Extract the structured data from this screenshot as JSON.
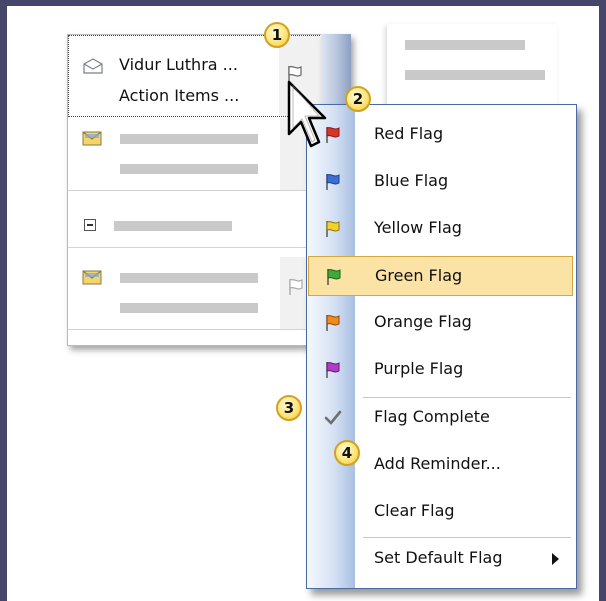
{
  "colors": {
    "background": "#45466a",
    "menu_border": "#4b6aa5",
    "highlight_fill": "#fbe3a6",
    "highlight_border": "#d1a740",
    "callout_fill": "#fde57d",
    "red_flag": "#d9342b",
    "blue_flag": "#3b6fd6",
    "yellow_flag": "#f2d12b",
    "green_flag": "#3faa3a",
    "orange_flag": "#f08a1c",
    "purple_flag": "#b23cc9"
  },
  "message_list": {
    "row1": {
      "sender": "Vidur Luthra ...",
      "subject": "Action Items ..."
    }
  },
  "context_menu": {
    "items": [
      {
        "label": "Red Flag",
        "icon": "red-flag-icon"
      },
      {
        "label": "Blue Flag",
        "icon": "blue-flag-icon"
      },
      {
        "label": "Yellow Flag",
        "icon": "yellow-flag-icon"
      },
      {
        "label": "Green Flag",
        "icon": "green-flag-icon",
        "highlighted": true
      },
      {
        "label": "Orange Flag",
        "icon": "orange-flag-icon"
      },
      {
        "label": "Purple Flag",
        "icon": "purple-flag-icon"
      },
      {
        "label": "Flag Complete",
        "icon": "checkmark-icon"
      },
      {
        "label": "Add Reminder...",
        "icon": ""
      },
      {
        "label": "Clear Flag",
        "icon": ""
      },
      {
        "label": "Set Default Flag",
        "icon": "submenu-arrow-icon"
      }
    ]
  },
  "callouts": [
    "1",
    "2",
    "3",
    "4"
  ]
}
